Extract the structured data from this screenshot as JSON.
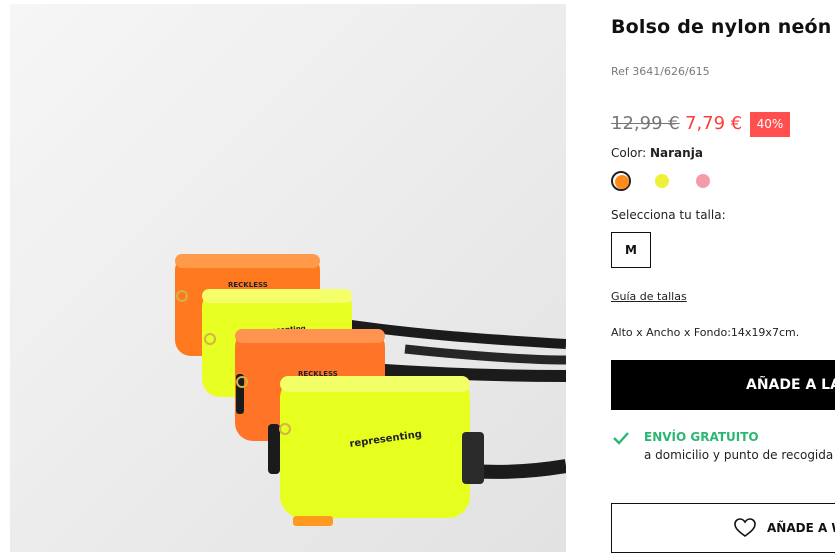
{
  "product": {
    "title": "Bolso de nylon neón",
    "ref": "Ref 3641/626/615",
    "old_price": "12,99 €",
    "new_price": "7,79 €",
    "discount": "40%",
    "color_label": "Color:",
    "color_value": "Naranja",
    "colors": [
      {
        "name": "orange",
        "hex": "#ff8c1a",
        "selected": true
      },
      {
        "name": "yellow",
        "hex": "#eef03a",
        "selected": false
      },
      {
        "name": "pink",
        "hex": "#f59aab",
        "selected": false
      }
    ],
    "size_label": "Selecciona tu talla:",
    "size": "M",
    "size_guide": "Guía de tallas",
    "dimensions": "Alto x Ancho x Fondo:14x19x7cm.",
    "add_to_cart": "AÑADE A LA",
    "shipping_title": "ENVÍO GRATUITO",
    "shipping_sub": "a domicilio y punto de recogida",
    "wishlist": "AÑADE A W"
  },
  "image": {
    "bag_print_1": "RECKLESS",
    "bag_print_2": "representing",
    "accent_orange": "#ff7a1f",
    "accent_yellow": "#eaff1f"
  },
  "icons": {
    "check": "check-icon",
    "heart": "heart-icon"
  }
}
